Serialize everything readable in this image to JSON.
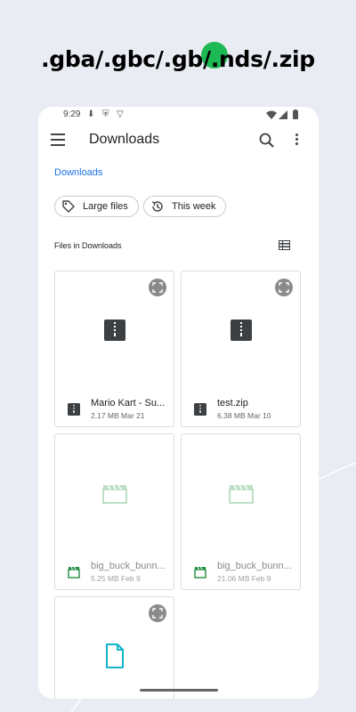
{
  "headline": ".gba/.gbc/.gb/.nds/.zip",
  "status_bar": {
    "time": "9:29"
  },
  "app_bar": {
    "title": "Downloads"
  },
  "breadcrumb": "Downloads",
  "chips": [
    {
      "label": "Large files",
      "icon": "tag-icon"
    },
    {
      "label": "This week",
      "icon": "history-icon"
    }
  ],
  "section_title": "Files in Downloads",
  "files": [
    {
      "name": "Mario Kart - Su...",
      "meta": "2.17 MB Mar 21",
      "type": "zip",
      "icon": "zip-file-icon"
    },
    {
      "name": "test.zip",
      "meta": "6.38 MB Mar 10",
      "type": "zip",
      "icon": "zip-file-icon"
    },
    {
      "name": "big_buck_bunn...",
      "meta": "5.25 MB Feb 9",
      "type": "video",
      "icon": "video-file-icon"
    },
    {
      "name": "big_buck_bunn...",
      "meta": "21.06 MB Feb 9",
      "type": "video",
      "icon": "video-file-icon"
    },
    {
      "name": "",
      "meta": "",
      "type": "document",
      "icon": "document-file-icon"
    }
  ],
  "colors": {
    "accent": "#1a73e8",
    "zip_icon": "#3c4043",
    "video_icon": "#1e8e3e",
    "doc_icon": "#12b5cb",
    "headline_dot": "#1db954"
  }
}
